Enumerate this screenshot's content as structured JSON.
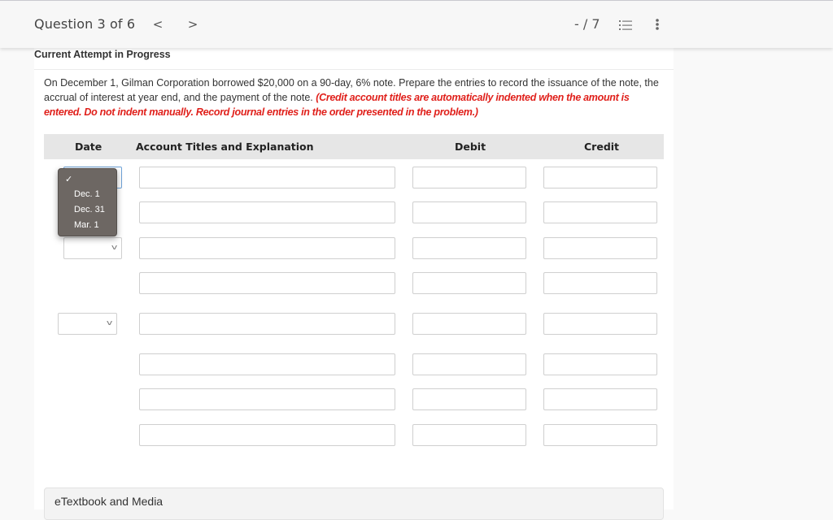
{
  "header": {
    "question_label": "Question 3 of 6",
    "prev_icon": "chevron-left-icon",
    "next_icon": "chevron-right-icon",
    "prev_glyph": "<",
    "next_glyph": ">",
    "score": "- / 7",
    "list_icon": "numbered-list-icon",
    "more_icon": "vertical-ellipsis-icon"
  },
  "attempt_label": "Current Attempt in Progress",
  "question": {
    "text": "On December 1, Gilman Corporation borrowed $20,000 on a 90-day, 6% note. Prepare the entries to record the issuance of the note, the accrual of interest at year end, and the payment of the note. ",
    "instruction": "(Credit account titles are automatically indented when the amount is entered. Do not indent manually. Record journal entries in the order presented in the problem.)",
    "instruction_color": "#e0201b"
  },
  "table": {
    "headers": {
      "date": "Date",
      "account": "Account Titles and Explanation",
      "debit": "Debit",
      "credit": "Credit"
    },
    "entries": [
      {
        "date": "",
        "rows": [
          {
            "account": "",
            "debit": "",
            "credit": ""
          },
          {
            "account": "",
            "debit": "",
            "credit": ""
          }
        ]
      },
      {
        "date": "",
        "rows": [
          {
            "account": "",
            "debit": "",
            "credit": ""
          },
          {
            "account": "",
            "debit": "",
            "credit": ""
          }
        ]
      },
      {
        "date": "",
        "rows": [
          {
            "account": "",
            "debit": "",
            "credit": ""
          },
          {
            "account": "",
            "debit": "",
            "credit": ""
          },
          {
            "account": "",
            "debit": "",
            "credit": ""
          },
          {
            "account": "",
            "debit": "",
            "credit": ""
          }
        ]
      }
    ]
  },
  "date_dropdown": {
    "open": true,
    "selected": "",
    "check_glyph": "✓",
    "options": [
      "Dec. 1",
      "Dec. 31",
      "Mar. 1"
    ]
  },
  "etextbook_label": "eTextbook and Media"
}
